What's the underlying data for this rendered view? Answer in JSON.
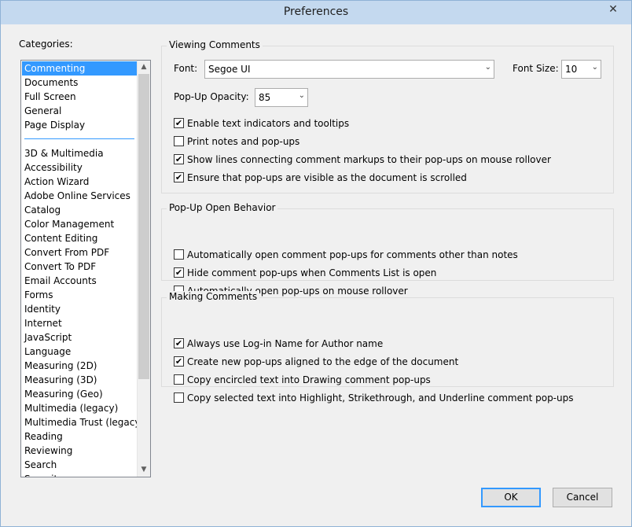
{
  "window": {
    "title": "Preferences",
    "close_glyph": "✕"
  },
  "categories": {
    "label": "Categories:",
    "group1": [
      "Commenting",
      "Documents",
      "Full Screen",
      "General",
      "Page Display"
    ],
    "group2": [
      "3D & Multimedia",
      "Accessibility",
      "Action Wizard",
      "Adobe Online Services",
      "Catalog",
      "Color Management",
      "Content Editing",
      "Convert From PDF",
      "Convert To PDF",
      "Email Accounts",
      "Forms",
      "Identity",
      "Internet",
      "JavaScript",
      "Language",
      "Measuring (2D)",
      "Measuring (3D)",
      "Measuring (Geo)",
      "Multimedia (legacy)",
      "Multimedia Trust (legacy)",
      "Reading",
      "Reviewing",
      "Search",
      "Security"
    ],
    "selected": "Commenting"
  },
  "viewing": {
    "title": "Viewing Comments",
    "font_label": "Font:",
    "font_value": "Segoe UI",
    "fontsize_label": "Font Size:",
    "fontsize_value": "10",
    "opacity_label": "Pop-Up Opacity:",
    "opacity_value": "85",
    "checks": [
      {
        "label": "Enable text indicators and tooltips",
        "checked": true
      },
      {
        "label": "Print notes and pop-ups",
        "checked": false
      },
      {
        "label": "Show lines connecting comment markups to their pop-ups on mouse rollover",
        "checked": true
      },
      {
        "label": "Ensure that pop-ups are visible as the document is scrolled",
        "checked": true
      }
    ]
  },
  "popup": {
    "title": "Pop-Up Open Behavior",
    "checks": [
      {
        "label": "Automatically open comment pop-ups for comments other than notes",
        "checked": false
      },
      {
        "label": "Hide comment pop-ups when Comments List is open",
        "checked": true
      },
      {
        "label": "Automatically open pop-ups on mouse rollover",
        "checked": false
      }
    ]
  },
  "making": {
    "title": "Making Comments",
    "checks": [
      {
        "label": "Always use Log-in Name for Author name",
        "checked": true
      },
      {
        "label": "Create new pop-ups aligned to the edge of the document",
        "checked": true
      },
      {
        "label": "Copy encircled text into Drawing comment pop-ups",
        "checked": false
      },
      {
        "label": "Copy selected text into Highlight, Strikethrough, and Underline comment pop-ups",
        "checked": false
      }
    ]
  },
  "buttons": {
    "ok": "OK",
    "cancel": "Cancel"
  },
  "glyphs": {
    "check": "✔",
    "down": "▼",
    "up": "▲",
    "combo": "⌄"
  },
  "colors": {
    "selection": "#3399ff",
    "titlebar": "#c4d9ef"
  }
}
